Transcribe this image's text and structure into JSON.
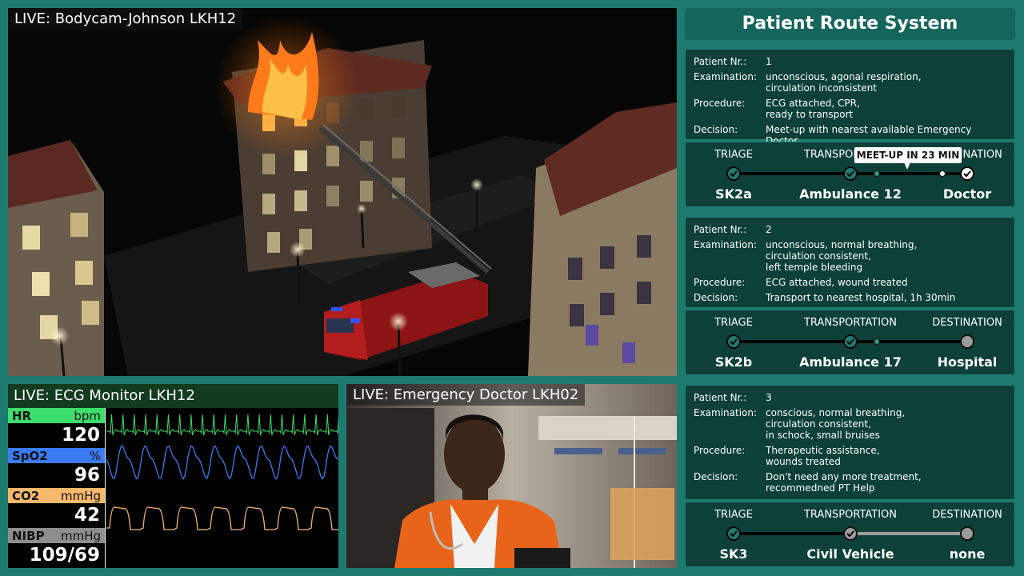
{
  "bodycam": {
    "label": "LIVE: Bodycam-Johnson LKH12"
  },
  "ecg": {
    "label": "LIVE: ECG Monitor LKH12",
    "vitals": [
      {
        "name": "HR",
        "unit": "bpm",
        "value": "120",
        "color": "#3cde6c"
      },
      {
        "name": "SpO2",
        "unit": "%",
        "value": "96",
        "color": "#3b7cf5"
      },
      {
        "name": "CO2",
        "unit": "mmHg",
        "value": "42",
        "color": "#f6b86a"
      },
      {
        "name": "NIBP",
        "unit": "mmHg",
        "value": "109/69",
        "color": "#8f8f8f"
      }
    ]
  },
  "doctor": {
    "label": "LIVE: Emergency Doctor LKH02"
  },
  "system": {
    "title": "Patient Route System"
  },
  "field_labels": {
    "patient": "Patient Nr.:",
    "examination": "Examination:",
    "procedure": "Procedure:",
    "decision": "Decision:"
  },
  "stage_labels": {
    "triage": "TRIAGE",
    "transportation": "TRANSPORTATION",
    "destination": "DESTINATION"
  },
  "patients": [
    {
      "nr": "1",
      "examination": "unconscious, agonal respiration,\ncirculation inconsistent",
      "procedure": "ECG attached, CPR,\nready to transport",
      "decision": "Meet-up with nearest available Emergency Doctor",
      "route": {
        "triage": "SK2a",
        "transportation": "Ambulance 12",
        "destination": "Doctor",
        "tooltip": "MEET-UP IN 23 MIN"
      }
    },
    {
      "nr": "2",
      "examination": "unconscious, normal breathing,\ncirculation consistent,\nleft temple bleeding",
      "procedure": "ECG attached, wound treated",
      "decision": "Transport to nearest hospital, 1h 30min",
      "route": {
        "triage": "SK2b",
        "transportation": "Ambulance 17",
        "destination": "Hospital"
      }
    },
    {
      "nr": "3",
      "examination": "conscious, normal breathing,\ncirculation consistent,\nin schock, small bruises",
      "procedure": "Therapeutic assistance,\nwounds treated",
      "decision": "Don't need any more treatment,\nrecommedned PT Help",
      "route": {
        "triage": "SK3",
        "transportation": "Civil Vehicle",
        "destination": "none"
      }
    }
  ]
}
